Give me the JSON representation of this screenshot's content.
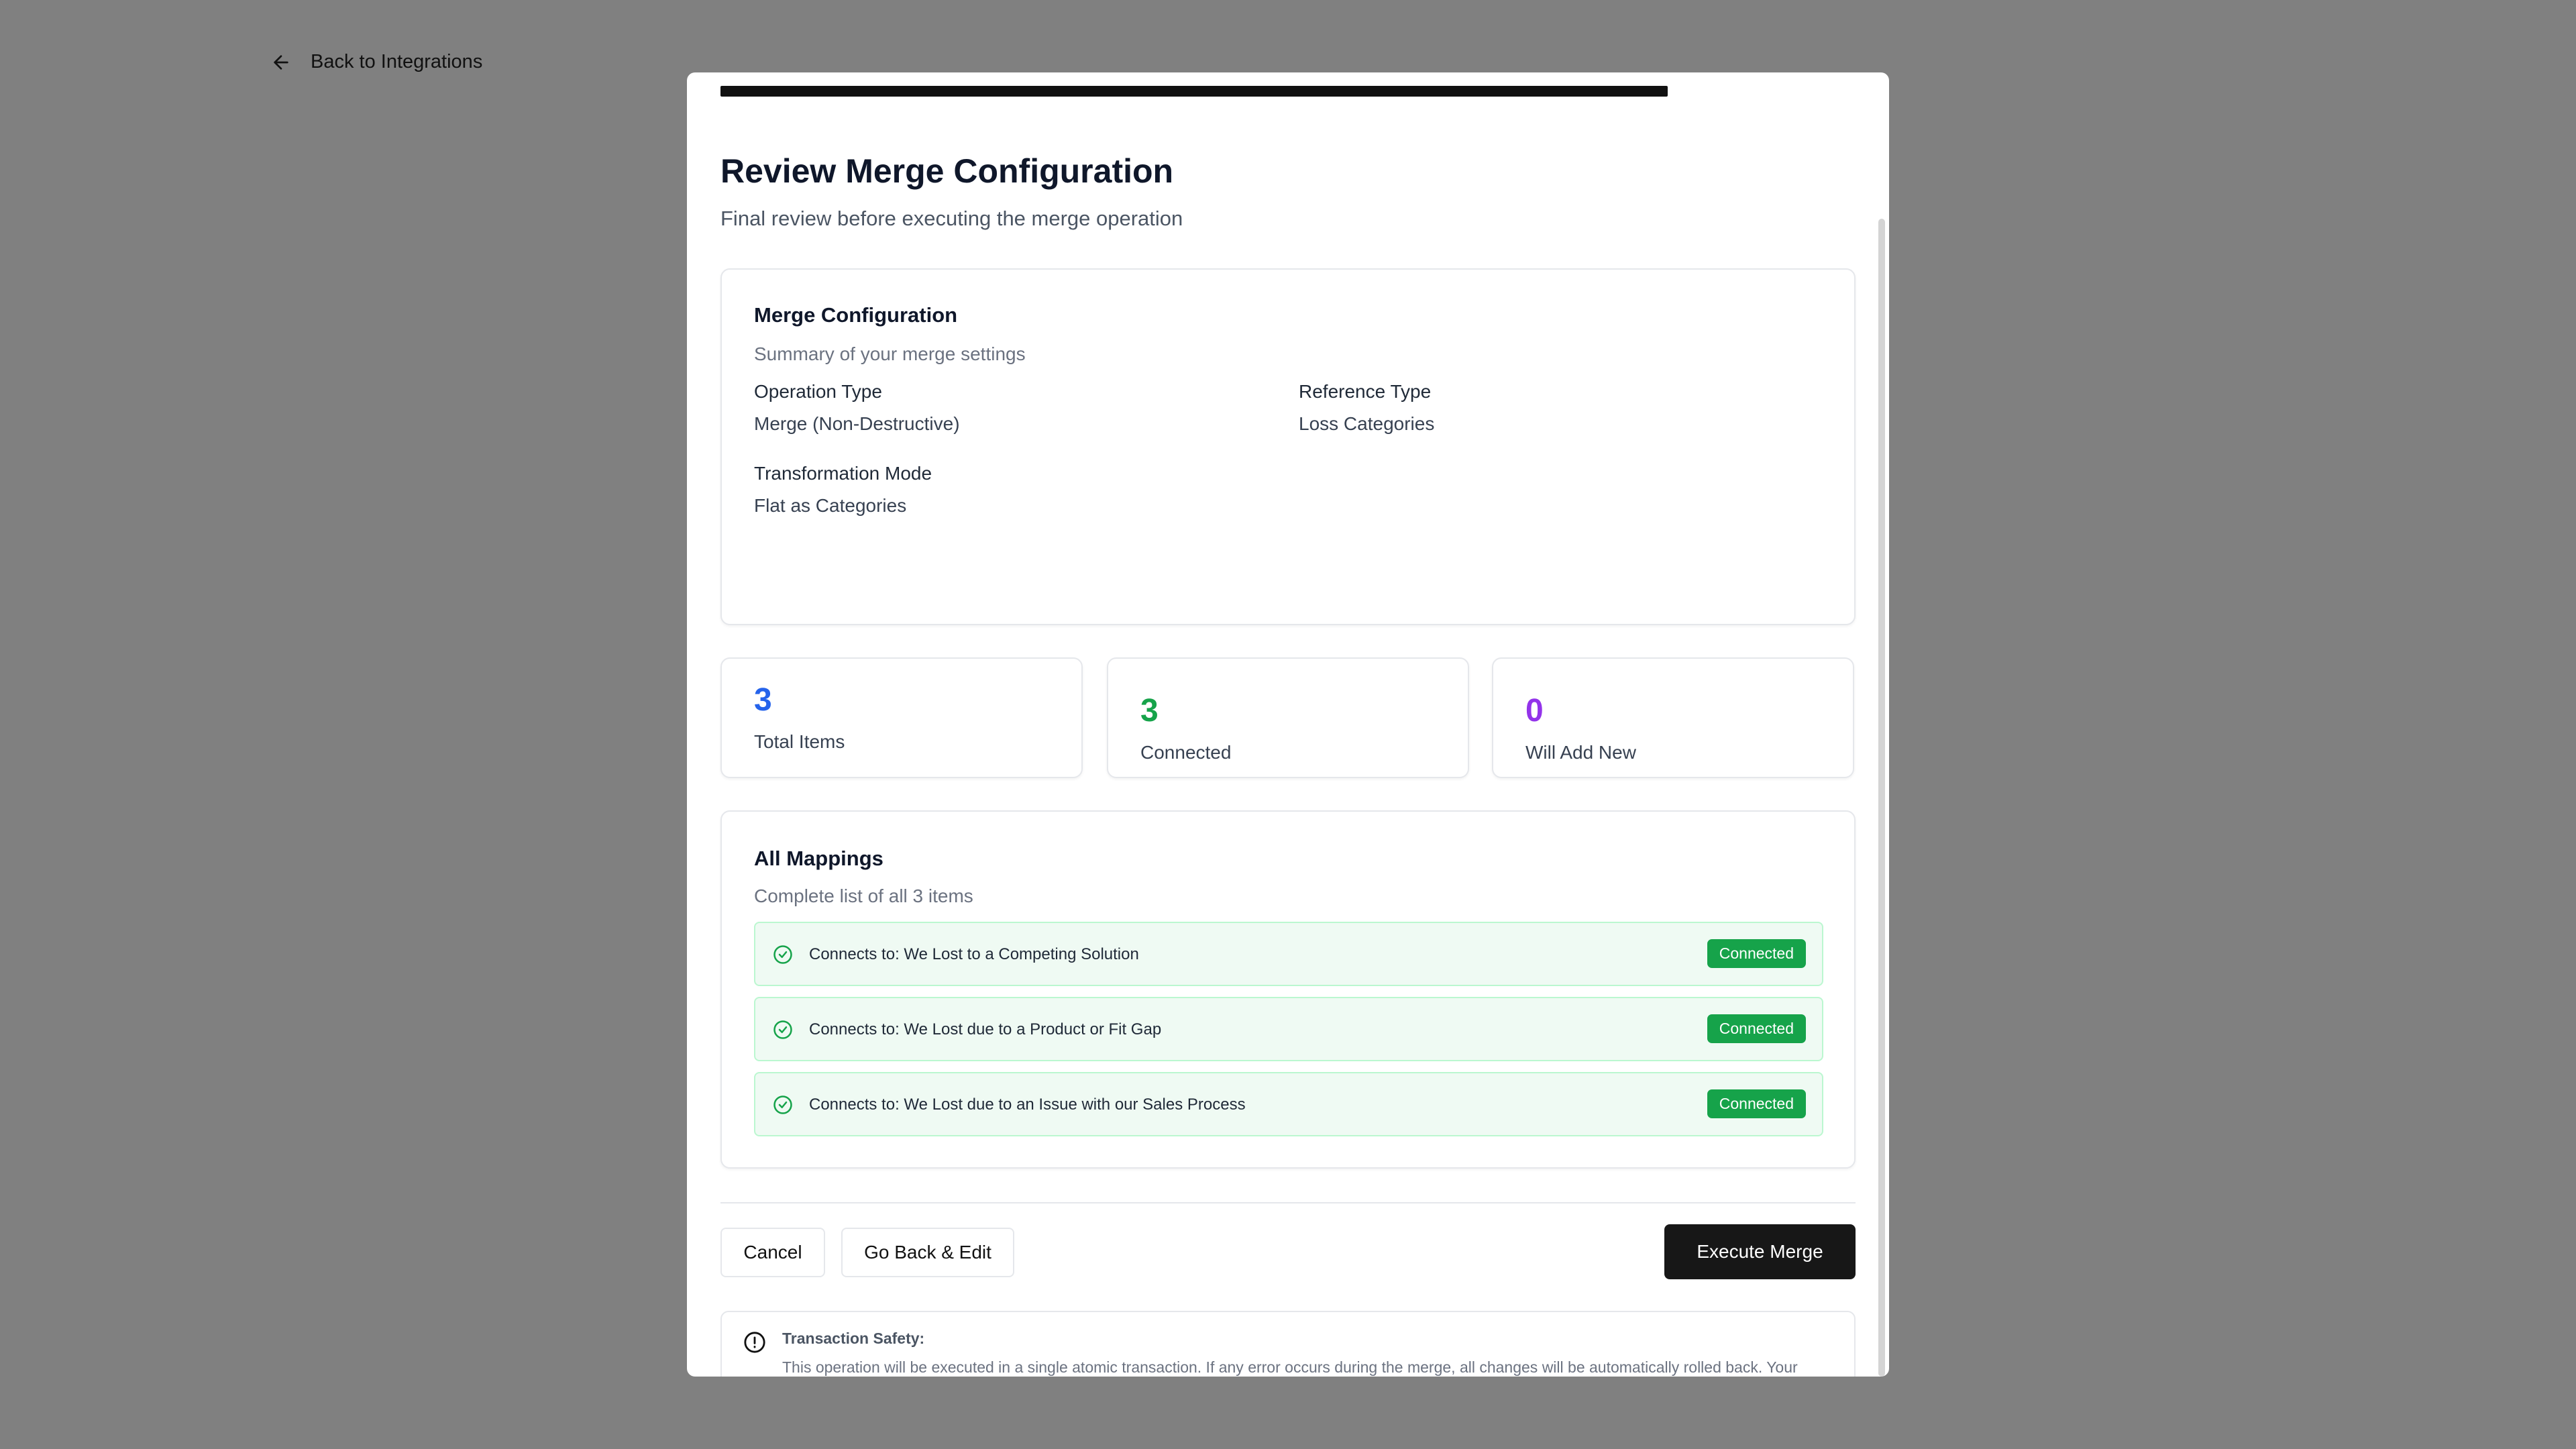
{
  "back_link": {
    "label": "Back to Integrations"
  },
  "progress": {
    "value": 0.86
  },
  "header": {
    "title": "Review Merge Configuration",
    "subtitle": "Final review before executing the merge operation"
  },
  "config": {
    "title": "Merge Configuration",
    "description": "Summary of your merge settings",
    "fields": [
      {
        "label": "Operation Type",
        "value": "Merge (Non-Destructive)"
      },
      {
        "label": "Reference Type",
        "value": "Loss Categories"
      },
      {
        "label": "Transformation Mode",
        "value": "Flat as Categories"
      }
    ]
  },
  "stats": [
    {
      "value": "3",
      "label": "Total Items",
      "color": "#2563eb"
    },
    {
      "value": "3",
      "label": "Connected",
      "color": "#16a34a"
    },
    {
      "value": "0",
      "label": "Will Add New",
      "color": "#9333ea"
    }
  ],
  "mappings": {
    "title": "All Mappings",
    "description": "Complete list of all 3 items",
    "items": [
      {
        "text": "Connects to: We Lost to a Competing Solution",
        "status": "Connected"
      },
      {
        "text": "Connects to: We Lost due to a Product or Fit Gap",
        "status": "Connected"
      },
      {
        "text": "Connects to: We Lost due to an Issue with our Sales Process",
        "status": "Connected"
      }
    ]
  },
  "actions": {
    "cancel": "Cancel",
    "go_back": "Go Back & Edit",
    "execute": "Execute Merge"
  },
  "notice": {
    "title": "Transaction Safety:",
    "body": "This operation will be executed in a single atomic transaction. If any error occurs during the merge, all changes will be automatically rolled back. Your existing data is protected."
  },
  "icons": {
    "back": "arrow-left-icon",
    "check": "check-circle-icon",
    "info": "alert-circle-icon"
  }
}
